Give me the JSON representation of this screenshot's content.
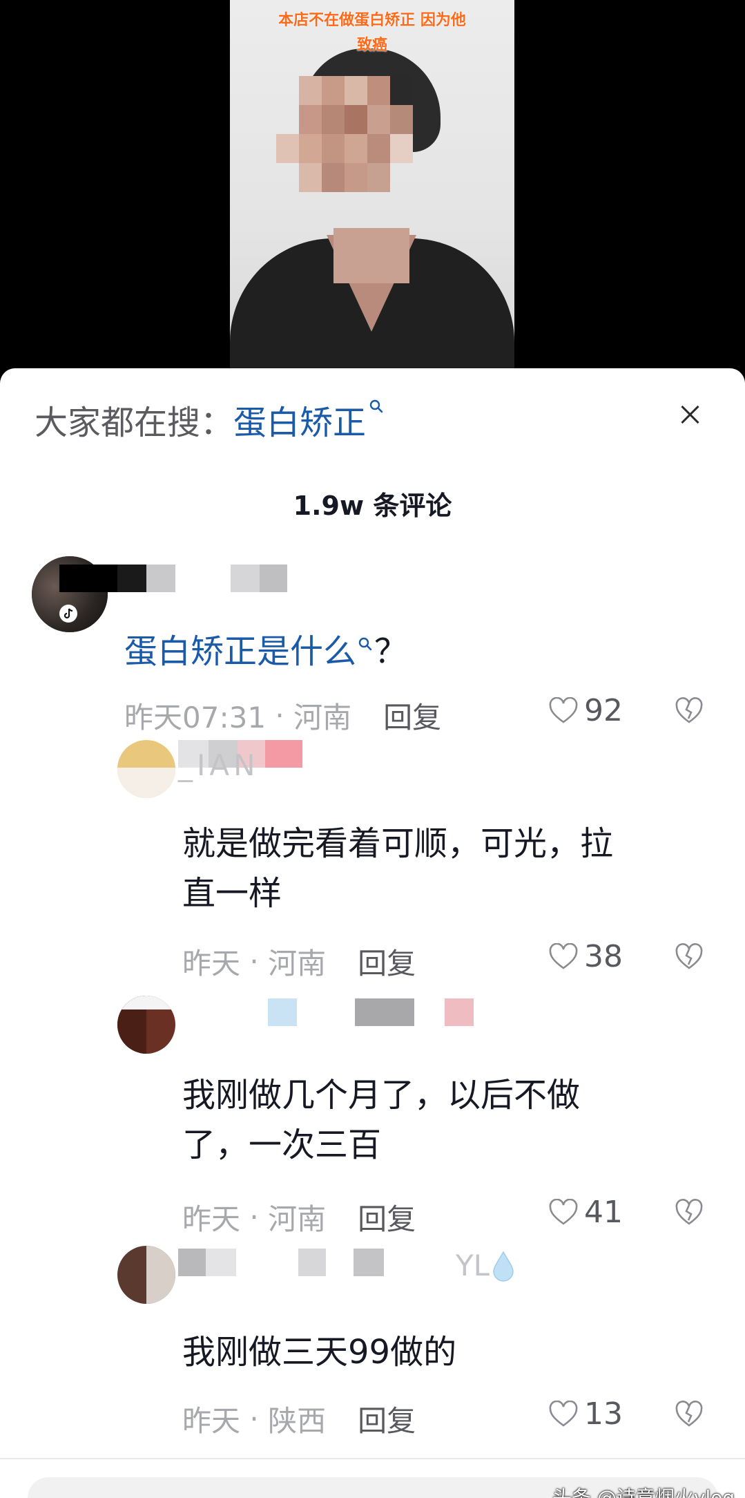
{
  "video": {
    "caption_line1": "本店不在做蛋白矫正 因为他",
    "caption_line2": "致癌"
  },
  "sheet": {
    "search_prefix": "大家都在搜：",
    "search_term": "蛋白矫正",
    "search_icon": "magnifier-icon",
    "close_icon": "close-icon",
    "comment_count": "1.9w 条评论"
  },
  "comments": [
    {
      "text_link": "蛋白矫正是什么",
      "text_tail": "？",
      "time": "昨天07:31",
      "location": "河南",
      "reply": "回复",
      "likes": "92"
    },
    {
      "name_fragment": "_IAN",
      "text_line1": "就是做完看着可顺，可光，拉",
      "text_line2": "直一样",
      "time": "昨天",
      "location": "河南",
      "reply": "回复",
      "likes": "38"
    },
    {
      "text_line1": "我刚做几个月了，以后不做",
      "text_line2": "了，一次三百",
      "time": "昨天",
      "location": "河南",
      "reply": "回复",
      "likes": "41"
    },
    {
      "name_fragment": "YL",
      "text_line1": "我刚做三天99做的",
      "time": "昨天",
      "location": "陕西",
      "reply": "回复",
      "likes": "13"
    }
  ],
  "watermark": "头条 @诗意烟火vlog",
  "colors": {
    "link_blue": "#1b5aa8",
    "caption_orange": "#ff6a1a",
    "meta_gray": "#a7a8ac"
  }
}
